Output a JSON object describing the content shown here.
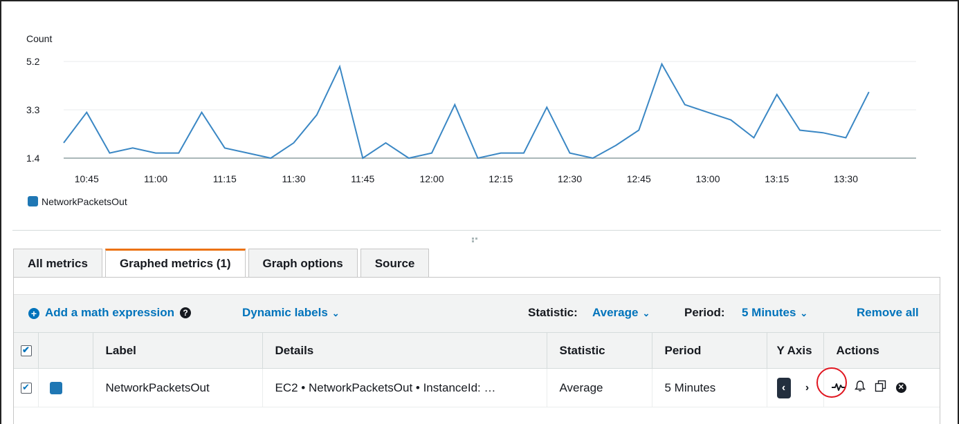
{
  "chart_data": {
    "type": "line",
    "ylabel": "Count",
    "yticks": [
      "1.4",
      "3.3",
      "5.2"
    ],
    "ylim": [
      1.4,
      5.2
    ],
    "xticks": [
      "10:45",
      "11:00",
      "11:15",
      "11:30",
      "11:45",
      "12:00",
      "12:15",
      "12:30",
      "12:45",
      "13:00",
      "13:15",
      "13:30"
    ],
    "x_start_minutes": 640,
    "x_step_minutes": 5,
    "series": [
      {
        "name": "NetworkPacketsOut",
        "color": "#3a87c4",
        "values": [
          2.0,
          3.2,
          1.6,
          1.8,
          1.6,
          1.6,
          3.2,
          1.8,
          1.6,
          1.4,
          2.0,
          3.1,
          5.0,
          1.4,
          2.0,
          1.4,
          1.6,
          3.5,
          1.4,
          1.6,
          1.6,
          3.4,
          1.6,
          1.4,
          1.9,
          2.5,
          5.1,
          3.5,
          3.2,
          2.9,
          2.2,
          3.9,
          2.5,
          2.4,
          2.2,
          4.0
        ]
      }
    ],
    "grid": true,
    "legend": "bottom-left"
  },
  "tabs": [
    {
      "label": "All metrics"
    },
    {
      "label": "Graphed metrics (1)"
    },
    {
      "label": "Graph options"
    },
    {
      "label": "Source"
    }
  ],
  "toolbar": {
    "add_math": "Add a math expression",
    "dynamic_labels": "Dynamic labels",
    "statistic_label": "Statistic:",
    "statistic_value": "Average",
    "period_label": "Period:",
    "period_value": "5 Minutes",
    "remove_all": "Remove all"
  },
  "table": {
    "headers": {
      "label": "Label",
      "details": "Details",
      "statistic": "Statistic",
      "period": "Period",
      "yaxis": "Y Axis",
      "actions": "Actions"
    },
    "rows": [
      {
        "label": "NetworkPacketsOut",
        "details": "EC2 • NetworkPacketsOut • InstanceId: …",
        "statistic": "Average",
        "period": "5 Minutes",
        "color": "#1f77b4"
      }
    ]
  },
  "icons": [
    "add-circle-icon",
    "help-icon",
    "chevron-down-icon",
    "checkbox-icon",
    "chevron-left-icon",
    "chevron-right-icon",
    "graph-metric-icon",
    "bell-icon",
    "duplicate-icon",
    "close-icon"
  ]
}
